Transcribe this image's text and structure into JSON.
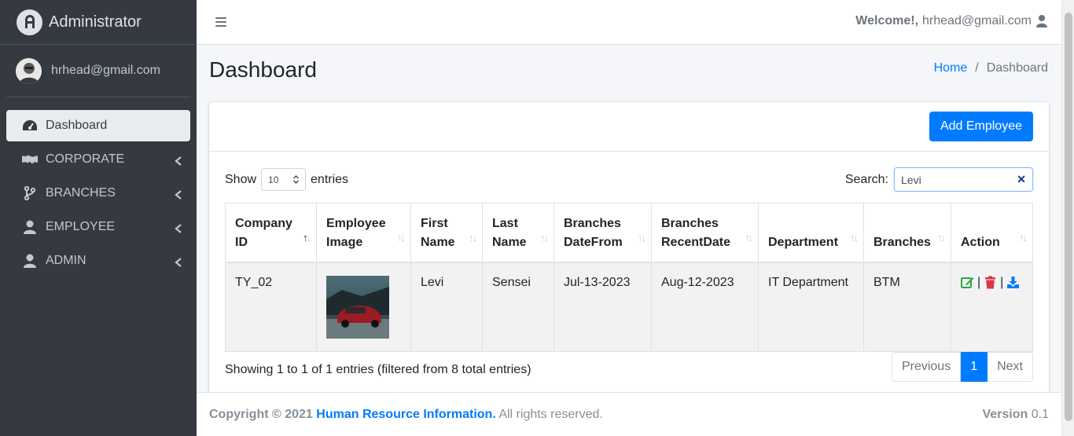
{
  "brand": {
    "title": "Administrator"
  },
  "user": {
    "email": "hrhead@gmail.com"
  },
  "sidebar": {
    "items": [
      {
        "label": "Dashboard",
        "icon": "tachometer-icon",
        "active": true
      },
      {
        "label": "CORPORATE",
        "icon": "handshake-icon"
      },
      {
        "label": "BRANCHES",
        "icon": "code-branch-icon"
      },
      {
        "label": "EMPLOYEE",
        "icon": "user-icon"
      },
      {
        "label": "ADMIN",
        "icon": "user-icon"
      }
    ]
  },
  "topbar": {
    "welcome_label": "Welcome!,",
    "email": "hrhead@gmail.com"
  },
  "page": {
    "title": "Dashboard"
  },
  "breadcrumb": {
    "home": "Home",
    "separator": "/",
    "current": "Dashboard"
  },
  "card": {
    "add_button": "Add Employee"
  },
  "table_controls": {
    "show_label": "Show",
    "entries_value": "10",
    "entries_label": "entries",
    "search_label": "Search:",
    "search_value": "Levi"
  },
  "table": {
    "headers": [
      [
        "Company",
        "ID"
      ],
      [
        "Employee",
        "Image"
      ],
      [
        "First",
        "Name"
      ],
      [
        "Last",
        "Name"
      ],
      [
        "Branches",
        "DateFrom"
      ],
      [
        "Branches",
        "RecentDate"
      ],
      [
        "Department",
        ""
      ],
      [
        "Branches",
        ""
      ],
      [
        "Action",
        ""
      ]
    ],
    "rows": [
      {
        "company_id": "TY_02",
        "first_name": "Levi",
        "last_name": "Sensei",
        "date_from": "Jul-13-2023",
        "recent_date": "Aug-12-2023",
        "department": "IT Department",
        "branch": "BTM",
        "separator": "|"
      }
    ]
  },
  "table_info": "Showing 1 to 1 of 1 entries (filtered from 8 total entries)",
  "pagination": {
    "previous": "Previous",
    "current": "1",
    "next": "Next"
  },
  "footer": {
    "copyright": "Copyright © 2021",
    "org": "Human Resource Information.",
    "rights": "All rights reserved.",
    "version_label": "Version",
    "version": "0.1"
  },
  "colors": {
    "sidebar_bg": "#343a40",
    "primary": "#007bff",
    "edit": "#28a745",
    "delete": "#dc3545",
    "download": "#007bff"
  }
}
